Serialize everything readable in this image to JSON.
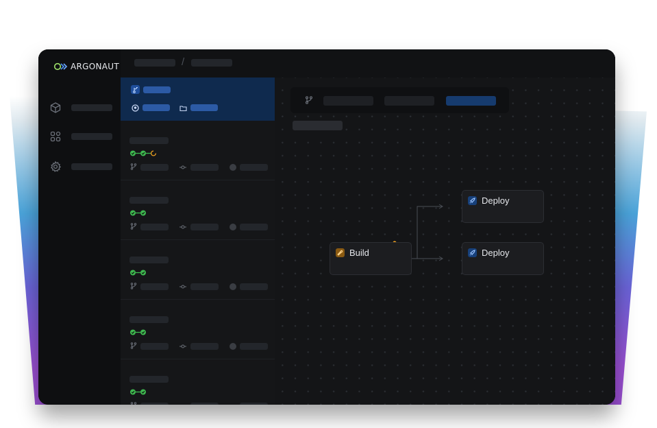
{
  "brand": {
    "name": "ARGONAUT",
    "accent": "#1f6feb",
    "success": "#3fb950",
    "pending": "#f0a020"
  },
  "sidebar": {
    "icons": [
      "cube-icon",
      "grid-icon",
      "gear-icon"
    ]
  },
  "pipeline": {
    "nodes": [
      {
        "label": "Build",
        "icon": "wrench-icon"
      },
      {
        "label": "Deploy",
        "icon": "rocket-icon"
      },
      {
        "label": "Deploy",
        "icon": "rocket-icon"
      }
    ]
  }
}
